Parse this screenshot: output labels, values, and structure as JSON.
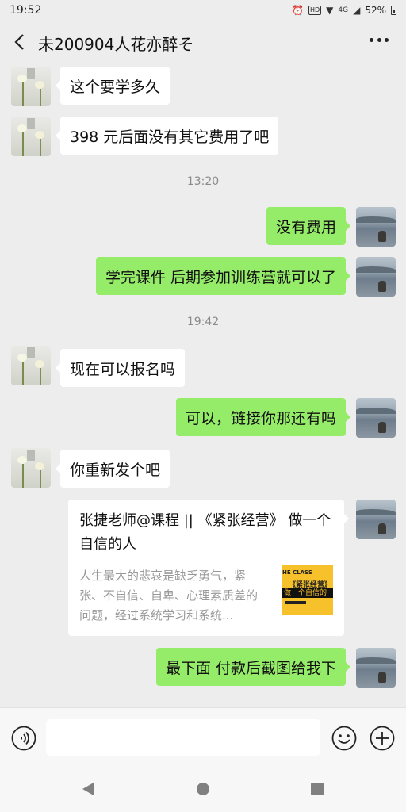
{
  "status_bar": {
    "time": "19:52",
    "hd_label": "HD",
    "network": "4G",
    "battery": "52%"
  },
  "header": {
    "title": "未200904人花亦醉そ"
  },
  "messages": [
    {
      "side": "in",
      "text": "这个要学多久"
    },
    {
      "side": "in",
      "text": "398 元后面没有其它费用了吧"
    },
    {
      "type": "time",
      "text": "13:20"
    },
    {
      "side": "out",
      "text": "没有费用"
    },
    {
      "side": "out",
      "text": "学完课件 后期参加训练营就可以了"
    },
    {
      "type": "time",
      "text": "19:42"
    },
    {
      "side": "in",
      "text": "现在可以报名吗"
    },
    {
      "side": "out",
      "text": "可以，链接你那还有吗"
    },
    {
      "side": "in",
      "text": "你重新发个吧"
    },
    {
      "side": "out",
      "text": "最下面  付款后截图给我下"
    }
  ],
  "link_card": {
    "title": "张捷老师@课程 || 《紧张经营》 做一个自信的人",
    "description": "人生最大的悲哀是缺乏勇气，紧张、不自信、自卑、心理素质差的问题，经过系统学习和系统...",
    "thumb_line1": "HE CLASS",
    "thumb_line2": "《紧张经营》",
    "thumb_line3": "做一个自信的人"
  },
  "input_bar": {
    "placeholder": ""
  },
  "colors": {
    "background": "#ededed",
    "outgoing_bubble": "#95ec69",
    "incoming_bubble": "#ffffff",
    "time_label": "#8a8a8a"
  }
}
